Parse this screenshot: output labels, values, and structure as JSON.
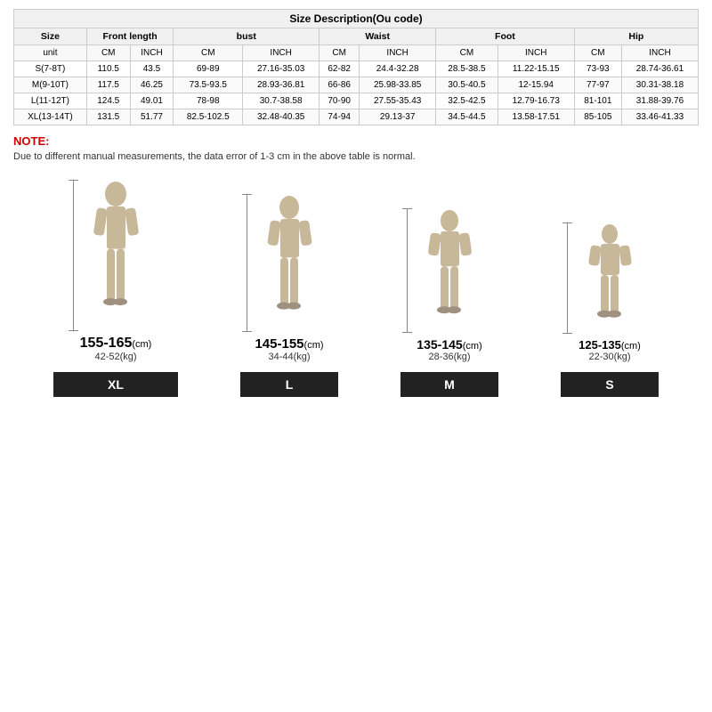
{
  "table": {
    "title": "Size Description(Ou code)",
    "columns": [
      {
        "label": "Size",
        "span": 1
      },
      {
        "label": "Front length",
        "span": 2
      },
      {
        "label": "bust",
        "span": 2
      },
      {
        "label": "Waist",
        "span": 2
      },
      {
        "label": "Foot",
        "span": 2
      },
      {
        "label": "Hip",
        "span": 2
      }
    ],
    "units": [
      "unit",
      "CM",
      "INCH",
      "CM",
      "INCH",
      "CM",
      "INCH",
      "CM",
      "INCH",
      "CM",
      "INCH"
    ],
    "rows": [
      {
        "size": "S(7-8T)",
        "data": [
          "110.5",
          "43.5",
          "69-89",
          "27.16-35.03",
          "62-82",
          "24.4-32.28",
          "28.5-38.5",
          "11.22-15.15",
          "73-93",
          "28.74-36.61"
        ]
      },
      {
        "size": "M(9-10T)",
        "data": [
          "117.5",
          "46.25",
          "73.5-93.5",
          "28.93-36.81",
          "66-86",
          "25.98-33.85",
          "30.5-40.5",
          "12-15.94",
          "77-97",
          "30.31-38.18"
        ]
      },
      {
        "size": "L(11-12T)",
        "data": [
          "124.5",
          "49.01",
          "78-98",
          "30.7-38.58",
          "70-90",
          "27.55-35.43",
          "32.5-42.5",
          "12.79-16.73",
          "81-101",
          "31.88-39.76"
        ]
      },
      {
        "size": "XL(13-14T)",
        "data": [
          "131.5",
          "51.77",
          "82.5-102.5",
          "32.48-40.35",
          "74-94",
          "29.13-37",
          "34.5-44.5",
          "13.58-17.51",
          "85-105",
          "33.46-41.33"
        ]
      }
    ]
  },
  "note": {
    "label": "NOTE:",
    "text": "Due to different manual measurements, the data error of 1-3 cm in the above table is normal."
  },
  "sizes": [
    {
      "size": "XL",
      "height": "155-165",
      "height_unit": "(cm)",
      "weight": "42-52(kg)",
      "badge_width": 140,
      "figure_height": 170
    },
    {
      "size": "L",
      "height": "145-155",
      "height_unit": "(cm)",
      "weight": "34-44(kg)",
      "badge_width": 110,
      "figure_height": 155
    },
    {
      "size": "M",
      "height": "135-145",
      "height_unit": "(cm)",
      "weight": "28-36(kg)",
      "badge_width": 110,
      "figure_height": 140
    },
    {
      "size": "S",
      "height": "125-135",
      "height_unit": "(cm)",
      "weight": "22-30(kg)",
      "badge_width": 110,
      "figure_height": 125
    }
  ]
}
